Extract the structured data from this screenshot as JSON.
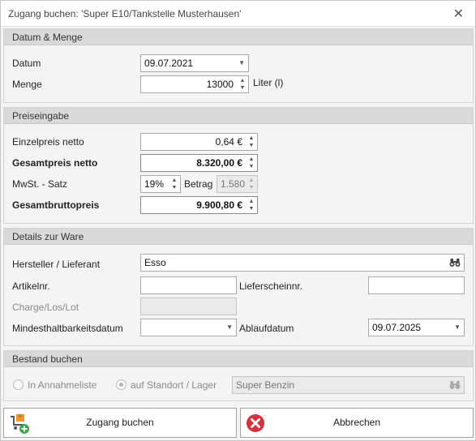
{
  "window": {
    "title": "Zugang buchen: 'Super E10/Tankstelle Musterhausen'",
    "close": "✕"
  },
  "datum_menge": {
    "header": "Datum & Menge",
    "datum_label": "Datum",
    "datum_value": "09.07.2021",
    "menge_label": "Menge",
    "menge_value": "13000",
    "menge_unit": "Liter (l)"
  },
  "preis": {
    "header": "Preiseingabe",
    "einzel_label": "Einzelpreis netto",
    "einzel_value": "0,64 €",
    "gesamt_netto_label": "Gesamtpreis netto",
    "gesamt_netto_value": "8.320,00 €",
    "mwst_label": "MwSt. - Satz",
    "mwst_value": "19%",
    "betrag_label": "Betrag",
    "betrag_value": "1.580",
    "brutto_label": "Gesamtbruttopreis",
    "brutto_value": "9.900,80 €"
  },
  "ware": {
    "header": "Details zur Ware",
    "hersteller_label": "Hersteller / Lieferant",
    "hersteller_value": "Esso",
    "artikel_label": "Artikelnr.",
    "artikel_value": "",
    "lieferschein_label": "Lieferscheinnr.",
    "lieferschein_value": "",
    "charge_label": "Charge/Los/Lot",
    "charge_value": "",
    "mhd_label": "Mindesthaltbarkeitsdatum",
    "mhd_value": "",
    "ablauf_label": "Ablaufdatum",
    "ablauf_value": "09.07.2025"
  },
  "bestand": {
    "header": "Bestand buchen",
    "opt1": "In Annahmeliste",
    "opt2": "auf Standort / Lager",
    "selected": "auf Standort / Lager",
    "standort_value": "Super Benzin"
  },
  "buttons": {
    "ok": "Zugang buchen",
    "cancel": "Abbrechen"
  },
  "colors": {
    "header_bg": "#d9d9d9",
    "cancel_icon": "#d9303a",
    "ok_icon_green": "#3aa845",
    "ok_icon_orange": "#f0962a"
  }
}
